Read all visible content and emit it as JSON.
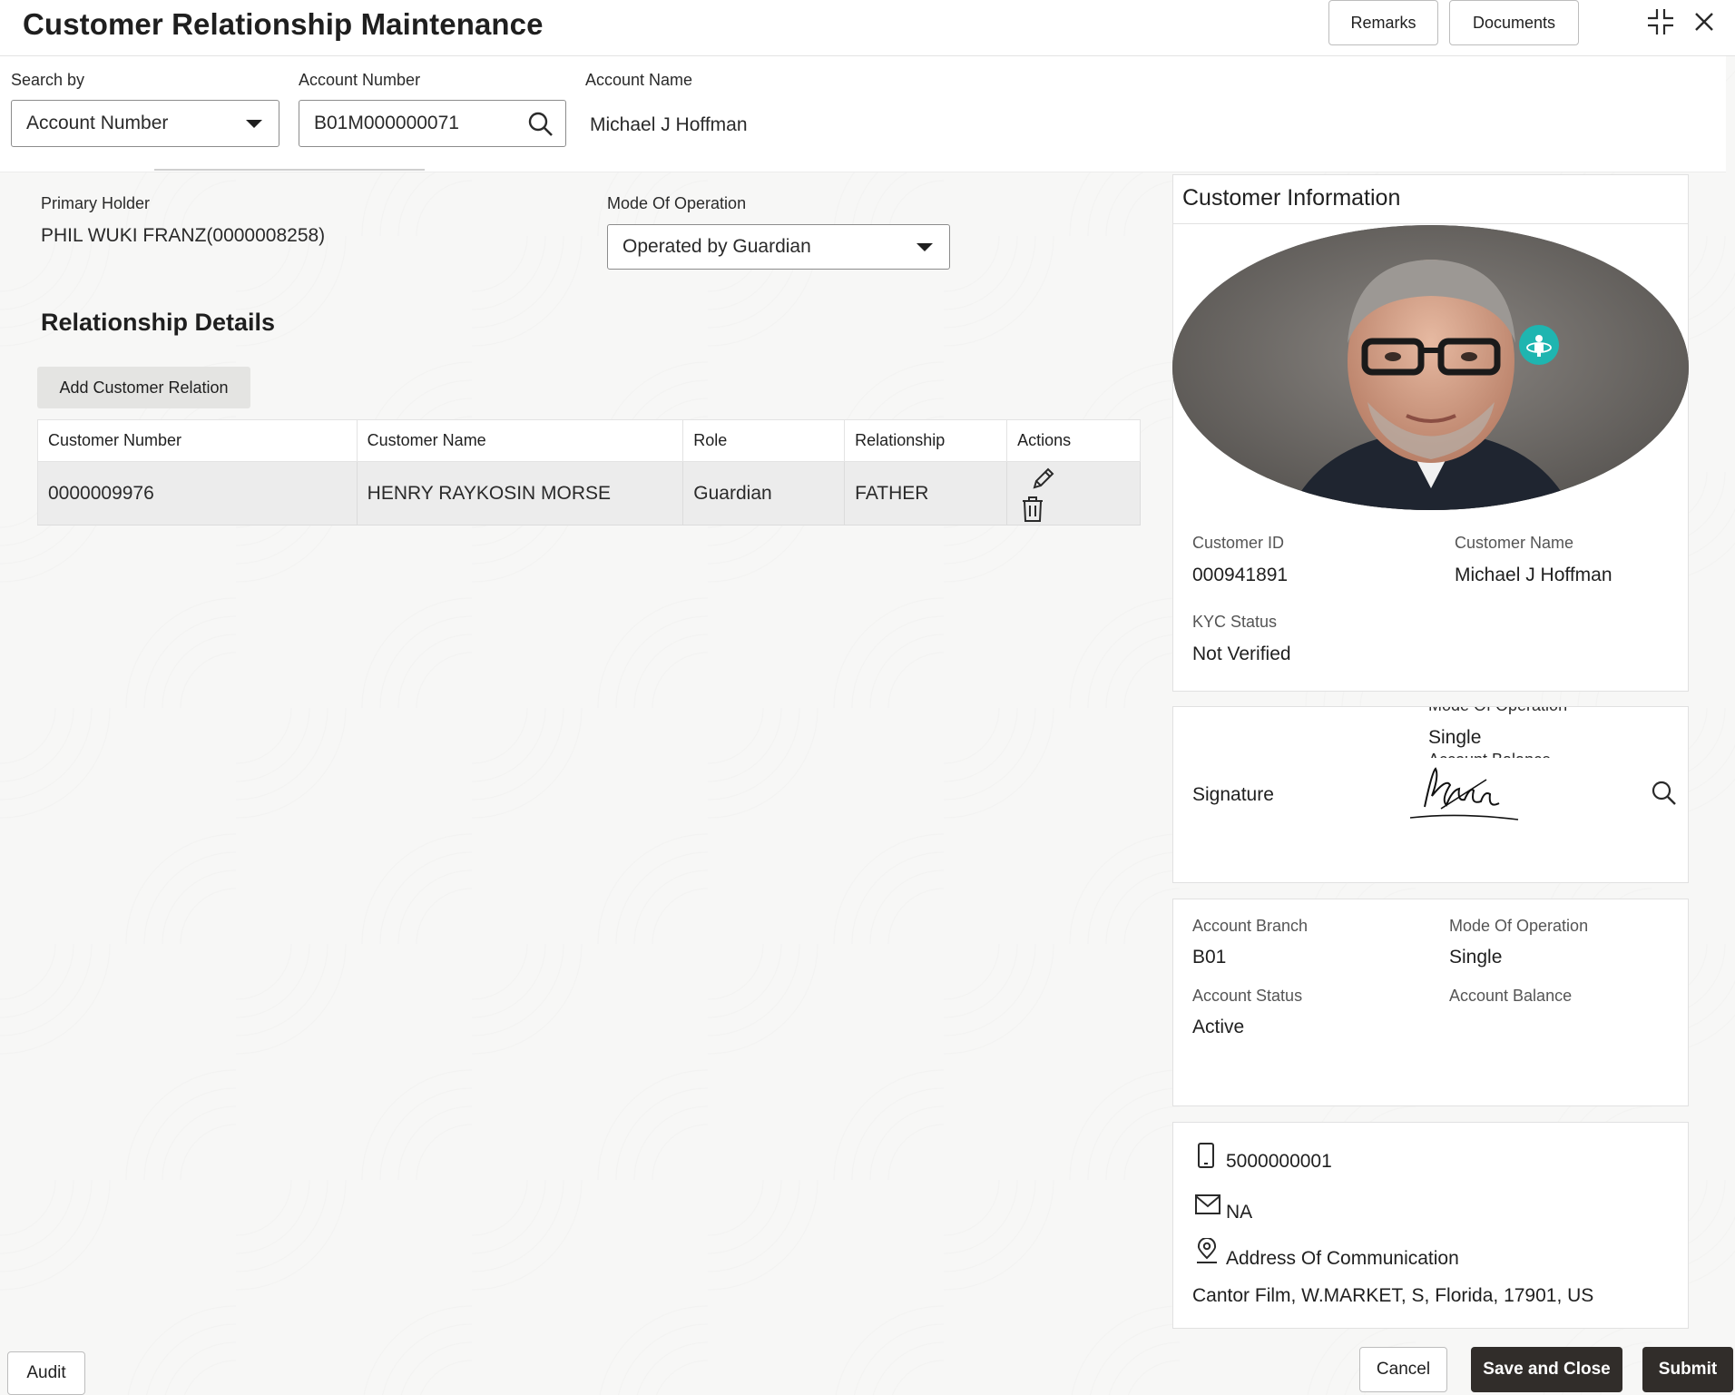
{
  "header": {
    "title": "Customer Relationship Maintenance",
    "remarks_label": "Remarks",
    "documents_label": "Documents"
  },
  "search": {
    "search_by_label": "Search by",
    "search_by_value": "Account Number",
    "account_number_label": "Account Number",
    "account_number_value": "B01M000000071",
    "account_name_label": "Account Name",
    "account_name_value": "Michael J Hoffman"
  },
  "primary": {
    "holder_label": "Primary Holder",
    "holder_value": "PHIL WUKI FRANZ(0000008258)",
    "mode_label": "Mode Of Operation",
    "mode_value": "Operated by Guardian"
  },
  "relationship": {
    "title": "Relationship Details",
    "add_button": "Add Customer Relation",
    "columns": [
      "Customer Number",
      "Customer Name",
      "Role",
      "Relationship",
      "Actions"
    ],
    "rows": [
      {
        "customer_number": "0000009976",
        "customer_name": "HENRY RAYKOSIN MORSE",
        "role": "Guardian",
        "relationship": "FATHER"
      }
    ]
  },
  "customer_info": {
    "title": "Customer Information",
    "customer_id_label": "Customer ID",
    "customer_id_value": "000941891",
    "customer_name_label": "Customer Name",
    "customer_name_value": "Michael J Hoffman",
    "kyc_label": "KYC Status",
    "kyc_value": "Not Verified"
  },
  "signature": {
    "label": "Signature",
    "overlay_mode_label": "Mode Of Operation",
    "overlay_mode_value": "Single",
    "overlay_balance_label": "Account Balance"
  },
  "account": {
    "branch_label": "Account Branch",
    "branch_value": "B01",
    "mode_label": "Mode Of Operation",
    "mode_value": "Single",
    "status_label": "Account Status",
    "status_value": "Active",
    "balance_label": "Account Balance",
    "balance_value": ""
  },
  "contact": {
    "phone": "5000000001",
    "email": "NA",
    "address_label": "Address Of Communication",
    "address_value": "Cantor Film, W.MARKET, S, Florida, 17901, US"
  },
  "footer": {
    "audit": "Audit",
    "cancel": "Cancel",
    "save_close": "Save and Close",
    "submit": "Submit"
  },
  "colors": {
    "accent_dark": "#312d2a",
    "badge_teal": "#1fb5b0"
  }
}
